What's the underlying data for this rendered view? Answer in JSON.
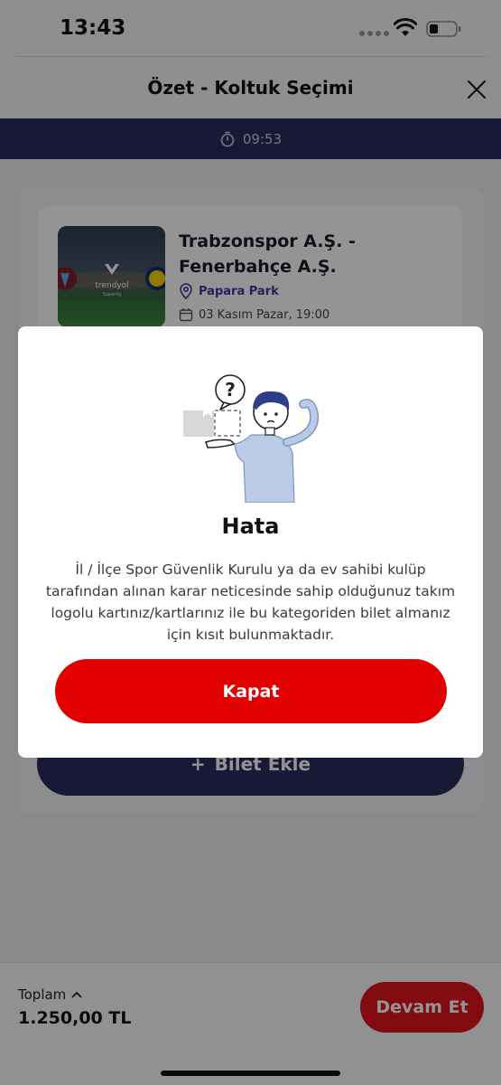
{
  "status_bar": {
    "time": "13:43"
  },
  "header": {
    "title": "Özet - Koltuk Seçimi"
  },
  "timer": {
    "value": "09:53"
  },
  "event": {
    "title": "Trabzonspor A.Ş. - Fenerbahçe A.Ş.",
    "venue": "Papara Park",
    "date": "03 Kasım Pazar, 19:00",
    "image_brand": "trendyol",
    "image_brand_sub": "Süperlig"
  },
  "add_ticket": {
    "label": "Bilet Ekle"
  },
  "footer": {
    "total_label": "Toplam",
    "total_value": "1.250,00 TL",
    "continue_label": "Devam Et"
  },
  "modal": {
    "title": "Hata",
    "message": "İl / İlçe Spor Güvenlik Kurulu ya da ev sahibi kulüp tarafından alınan karar neticesinde sahip olduğunuz takım logolu kartınız/kartlarınız ile bu kategoriden bilet almanız için kısıt bulunmaktadır.",
    "button_label": "Kapat",
    "illustration_glyph": "?"
  },
  "colors": {
    "primary_navy": "#2a2b5e",
    "accent_red": "#e00000",
    "venue_blue": "#3a3aa0"
  },
  "icons": [
    "wifi-icon",
    "battery-icon",
    "close-icon",
    "timer-icon",
    "location-pin-icon",
    "calendar-icon",
    "chevron-up-icon",
    "plus-icon"
  ]
}
